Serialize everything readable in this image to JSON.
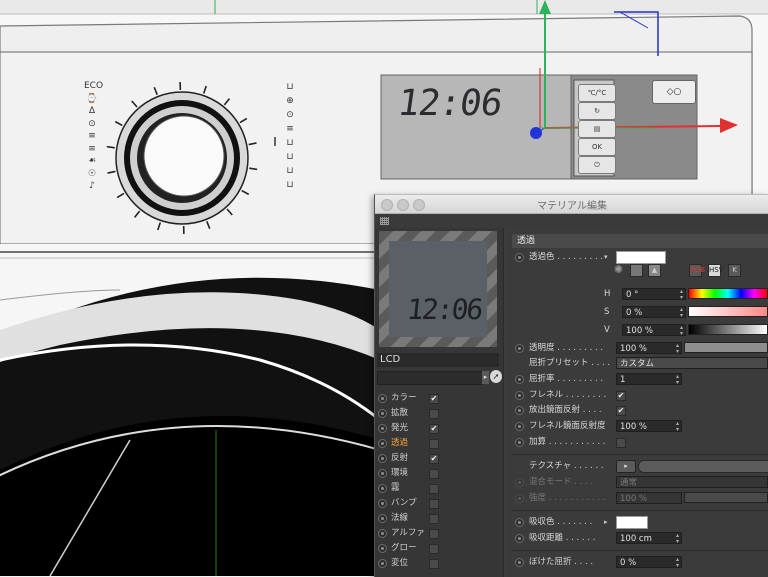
{
  "viewport": {
    "lcd_time": "12:06",
    "program_labels_left": [
      "ECO",
      "⌚",
      "∆",
      "⊙",
      "≡",
      "≡",
      "☙",
      "☉",
      "♪"
    ],
    "program_labels_right": [
      "⊔",
      "⊕",
      "⊙",
      "≡",
      "⊔",
      "⊔",
      "⊔",
      "⊔"
    ],
    "buttons": [
      "℃/°C",
      "↻",
      "▤",
      "OK",
      "⏻"
    ],
    "top_button": "◇○"
  },
  "editor": {
    "title": "マテリアル編集",
    "preview_time": "12:06",
    "material_name": "LCD",
    "channels": [
      {
        "label": "カラー",
        "checked": "✔"
      },
      {
        "label": "拡散",
        "checked": ""
      },
      {
        "label": "発光",
        "checked": "✔"
      },
      {
        "label": "透過",
        "checked": "",
        "active": true
      },
      {
        "label": "反射",
        "checked": "✔"
      },
      {
        "label": "環境",
        "checked": ""
      },
      {
        "label": "霧",
        "checked": ""
      },
      {
        "label": "バンプ",
        "checked": ""
      },
      {
        "label": "法線",
        "checked": ""
      },
      {
        "label": "アルファ",
        "checked": ""
      },
      {
        "label": "グロー",
        "checked": ""
      },
      {
        "label": "変位",
        "checked": ""
      }
    ],
    "section_title": "透過",
    "props": {
      "color_label": "透過色 . . . . . . . . .",
      "color_modes": [
        "RGB",
        "HSV",
        "K"
      ],
      "h_label": "H",
      "h_value": "0 °",
      "s_label": "S",
      "s_value": "0 %",
      "v_label": "V",
      "v_value": "100 %",
      "brightness_label": "透明度 . . . . . . . . .",
      "brightness_value": "100 %",
      "preset_label": "屈折プリセット . . . .",
      "preset_value": "カスタム",
      "ior_label": "屈折率 . . . . . . . . .",
      "ior_value": "1",
      "fresnel_label": "フレネル . . . . . . . .",
      "fresnel_check": "✔",
      "exit_label": "放出鏡面反射 . . . .",
      "exit_check": "✔",
      "fresnel_refl_label": "フレネル鏡面反射度",
      "fresnel_refl_value": "100 %",
      "add_label": "加算 . . . . . . . . . . .",
      "add_check": "",
      "texture_label": "テクスチャ . . . . . .",
      "texture_btn": "▸",
      "blend_label": "混合モード . . . .",
      "blend_value": "通常",
      "strength_label": "強度 . . . . . . . . . . .",
      "strength_value": "100 %",
      "absorb_color_label": "吸収色 . . . . . . .",
      "absorb_dist_label": "吸収距離 . . . . . .",
      "absorb_dist_value": "100 cm",
      "blur_label": "ぼけた屈折 . . . .",
      "blur_value": "0 %"
    }
  }
}
